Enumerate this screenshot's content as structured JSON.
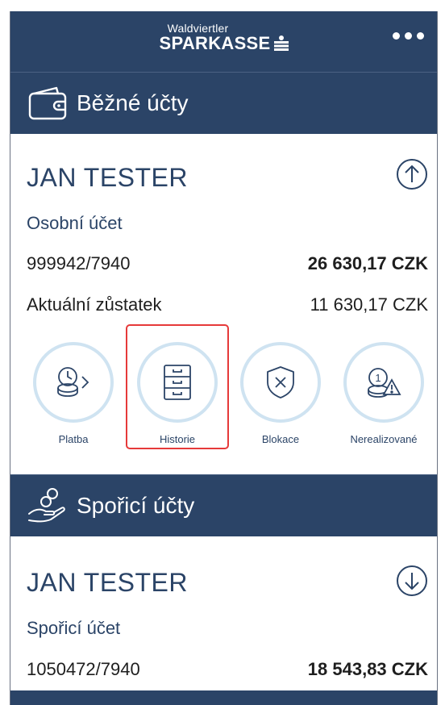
{
  "header": {
    "brand_small": "Waldviertler",
    "brand_big": "SPARKASSE",
    "menu_icon": "more-dots-icon"
  },
  "current_accounts": {
    "title": "Běžné účty",
    "icon": "wallet-icon",
    "account": {
      "owner": "JAN TESTER",
      "type": "Osobní účet",
      "number": "999942/7940",
      "balance": "26 630,17 CZK",
      "current_label": "Aktuální zůstatek",
      "current_balance": "11 630,17 CZK",
      "toggle_icon": "arrow-up-circle-icon"
    },
    "actions": [
      {
        "label": "Platba",
        "icon": "payment-coins-icon"
      },
      {
        "label": "Historie",
        "icon": "history-cabinet-icon"
      },
      {
        "label": "Blokace",
        "icon": "shield-block-icon"
      },
      {
        "label": "Nerealizované",
        "icon": "pending-warning-icon"
      }
    ]
  },
  "savings_accounts": {
    "title": "Spořicí účty",
    "icon": "savings-hand-icon",
    "account": {
      "owner": "JAN TESTER",
      "type": "Spořicí účet",
      "number": "1050472/7940",
      "balance": "18 543,83 CZK",
      "toggle_icon": "arrow-down-circle-icon"
    }
  },
  "colors": {
    "primary": "#2b4467",
    "circle_border": "#cfe3f1",
    "highlight": "#e63a3a"
  }
}
